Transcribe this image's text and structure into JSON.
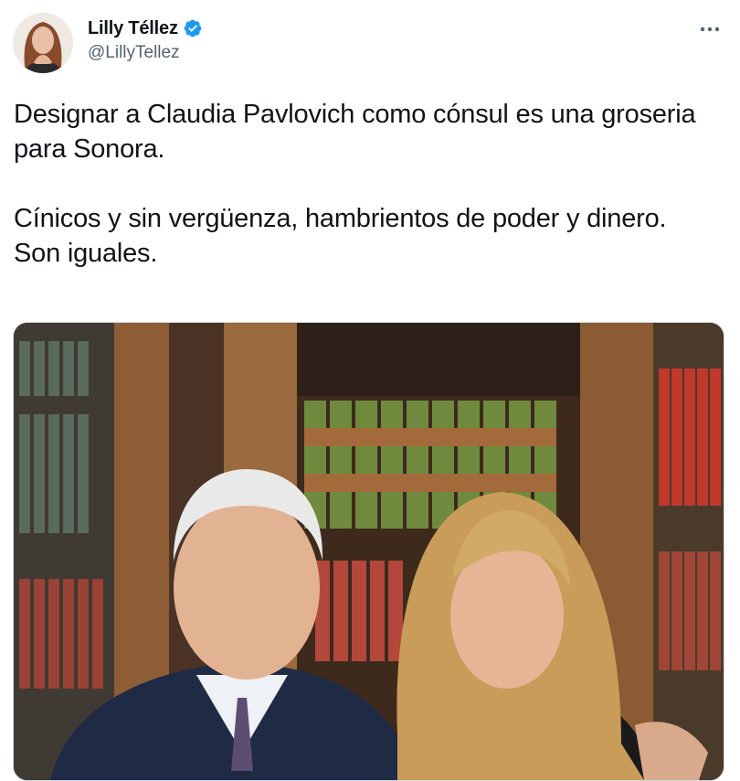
{
  "author": {
    "display_name": "Lilly Téllez",
    "handle": "@LillyTellez",
    "verified": true,
    "verified_color": "#1d9bf0"
  },
  "tweet": {
    "lines": [
      "Designar a Claudia Pavlovich como cónsul es una groseria para Sonora.",
      "Cínicos y sin vergüenza, hambrientos de poder y dinero.",
      "Son iguales."
    ]
  },
  "icons": {
    "more": "more-options-icon",
    "verified": "verified-badge-icon"
  },
  "colors": {
    "text": "#0f1419",
    "secondary": "#536471",
    "accent": "#1d9bf0"
  }
}
